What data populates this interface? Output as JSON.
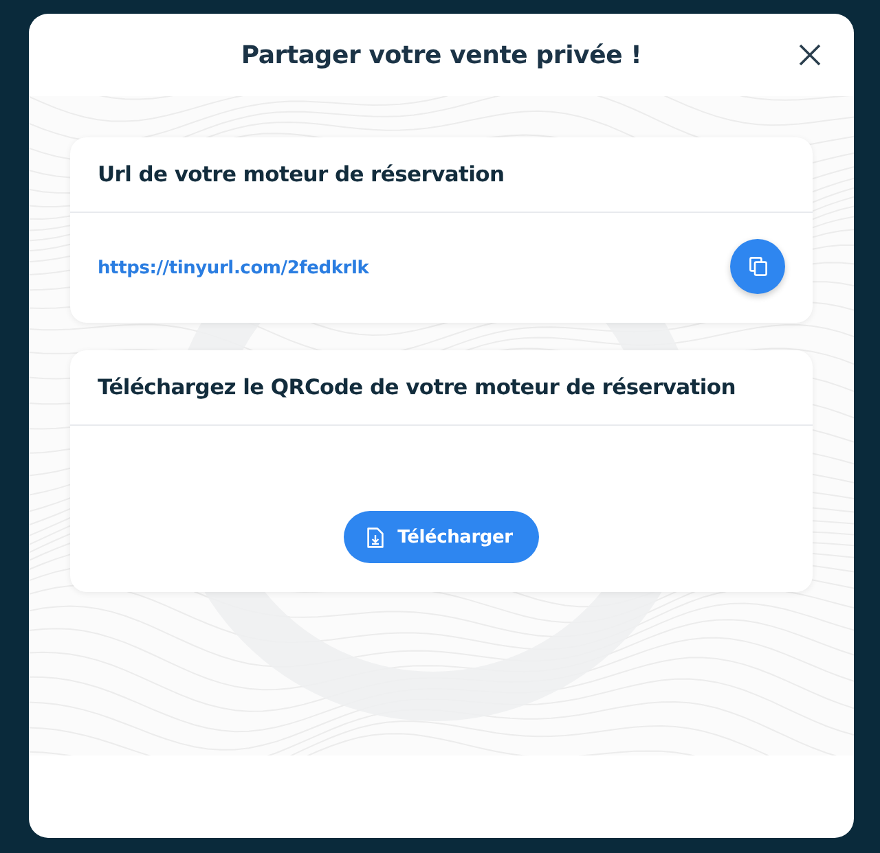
{
  "dialog": {
    "title": "Partager votre vente privée !"
  },
  "cards": [
    {
      "kind": "link",
      "title": "Url de votre moteur de réservation",
      "link": "https://tinyurl.com/2fedkrlk"
    },
    {
      "kind": "download",
      "title": "Téléchargez le QRCode de votre moteur de réservation",
      "button": "Télécharger"
    }
  ]
}
